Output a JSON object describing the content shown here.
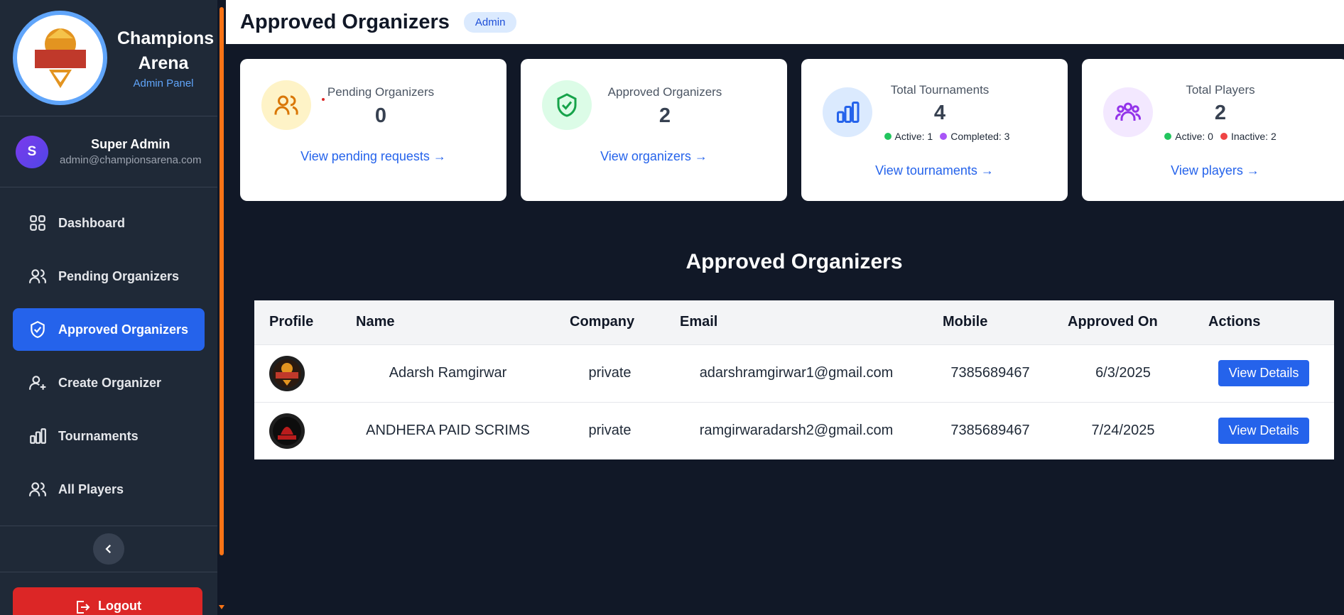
{
  "sidebar": {
    "brand_title": "Champions Arena",
    "brand_subtitle": "Admin Panel",
    "user": {
      "initial": "S",
      "name": "Super Admin",
      "email": "admin@championsarena.com"
    },
    "nav": [
      {
        "label": "Dashboard",
        "icon": "grid-icon",
        "active": false
      },
      {
        "label": "Pending Organizers",
        "icon": "users-icon",
        "active": false
      },
      {
        "label": "Approved Organizers",
        "icon": "shield-check-icon",
        "active": true
      },
      {
        "label": "Create Organizer",
        "icon": "user-plus-icon",
        "active": false
      },
      {
        "label": "Tournaments",
        "icon": "bar-chart-icon",
        "active": false
      },
      {
        "label": "All Players",
        "icon": "users-icon",
        "active": false
      }
    ],
    "logout_label": "Logout"
  },
  "header": {
    "title": "Approved Organizers",
    "badge": "Admin"
  },
  "cards": {
    "pending": {
      "label": "Pending Organizers",
      "value": "0",
      "link": "View pending requests →"
    },
    "approved": {
      "label": "Approved Organizers",
      "value": "2",
      "link": "View organizers →"
    },
    "tournaments": {
      "label": "Total Tournaments",
      "value": "4",
      "active": "Active: 1",
      "completed": "Completed: 3",
      "link": "View tournaments →"
    },
    "players": {
      "label": "Total Players",
      "value": "2",
      "active": "Active: 0",
      "inactive": "Inactive: 2",
      "link": "View players →"
    }
  },
  "table": {
    "title": "Approved Organizers",
    "headers": [
      "Profile",
      "Name",
      "Company",
      "Email",
      "Mobile",
      "Approved On",
      "Actions"
    ],
    "rows": [
      {
        "name": "Adarsh Ramgirwar",
        "company": "private",
        "email": "adarshramgirwar1@gmail.com",
        "mobile": "7385689467",
        "approved_on": "6/3/2025",
        "action": "View Details"
      },
      {
        "name": "ANDHERA PAID SCRIMS",
        "company": "private",
        "email": "ramgirwaradarsh2@gmail.com",
        "mobile": "7385689467",
        "approved_on": "7/24/2025",
        "action": "View Details"
      }
    ]
  },
  "colors": {
    "accent": "#2563eb",
    "sidebar_bg": "#1f2937",
    "page_bg": "#111827",
    "logout": "#dc2626",
    "scrollbar": "#f97316"
  }
}
